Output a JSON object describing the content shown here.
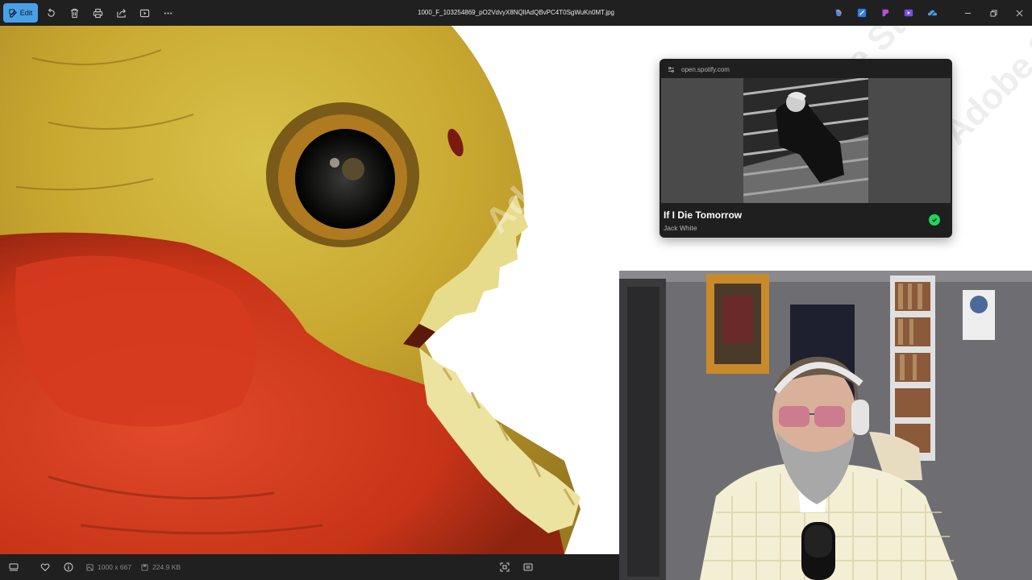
{
  "toolbar": {
    "edit_label": "Edit",
    "icons": [
      "rotate-icon",
      "delete-icon",
      "print-icon",
      "share-icon",
      "slideshow-icon",
      "more-icon"
    ]
  },
  "window": {
    "title": "1000_F_103254869_pO2VdvyX8NQllAdQBvPC4T0SgWuKn0MT.jpg"
  },
  "image": {
    "description_subject": "piranha",
    "watermark": "Adobe Stock"
  },
  "status_bar": {
    "dimensions": "1000 x 667",
    "file_size": "224.9 KB"
  },
  "spotify": {
    "url": "open.spotify.com",
    "track_title": "If I Die Tomorrow",
    "artist": "Jack White"
  },
  "colors": {
    "toolbar_bg": "#202020",
    "edit_accent": "#4aa0e6",
    "spotify_green": "#1ed760"
  }
}
